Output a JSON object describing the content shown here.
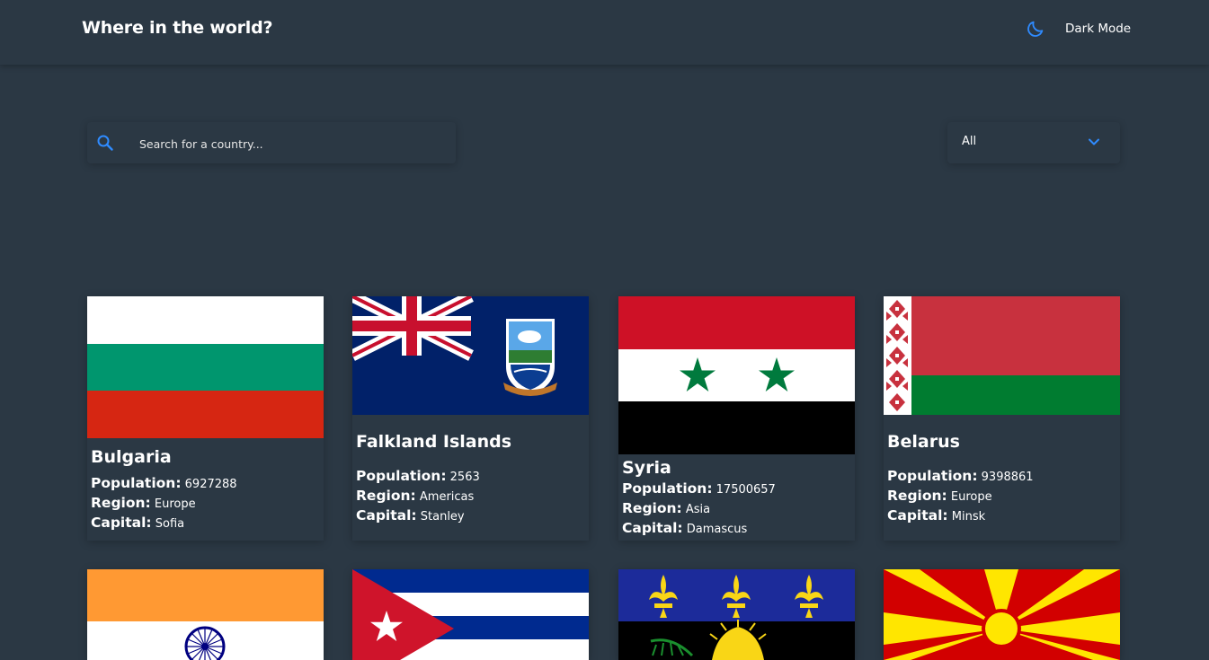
{
  "header": {
    "title": "Where in the world?",
    "mode_label": "Dark Mode",
    "mode_icon": "moon-icon",
    "accent": "#2f8bff"
  },
  "search": {
    "placeholder": "Search for a country...",
    "value": "",
    "icon": "search-icon"
  },
  "filter": {
    "selected": "All",
    "icon": "chevron-down-icon"
  },
  "labels": {
    "population": "Population:",
    "region": "Region:",
    "capital": "Capital:"
  },
  "countries": [
    {
      "name": "Bulgaria",
      "population": "6927288",
      "region": "Europe",
      "capital": "Sofia"
    },
    {
      "name": "Falkland Islands",
      "population": "2563",
      "region": "Americas",
      "capital": "Stanley"
    },
    {
      "name": "Syria",
      "population": "17500657",
      "region": "Asia",
      "capital": "Damascus"
    },
    {
      "name": "Belarus",
      "population": "9398861",
      "region": "Europe",
      "capital": "Minsk"
    },
    {
      "name": "India"
    },
    {
      "name": "Cuba"
    },
    {
      "name": "Guadeloupe"
    },
    {
      "name": "North Macedonia"
    }
  ]
}
